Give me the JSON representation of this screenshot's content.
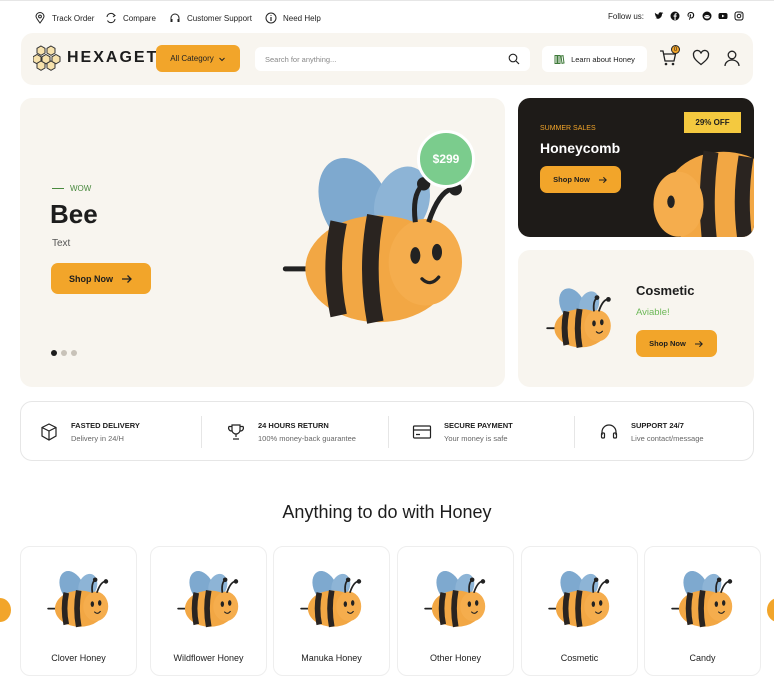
{
  "topbar": {
    "links": [
      {
        "label": "Track Order",
        "icon": "location-pin-icon"
      },
      {
        "label": "Compare",
        "icon": "compare-arrows-icon"
      },
      {
        "label": "Customer Support",
        "icon": "headphones-icon"
      },
      {
        "label": "Need Help",
        "icon": "info-icon"
      }
    ],
    "follow_label": "Follow us:",
    "socials": [
      "twitter-icon",
      "facebook-icon",
      "pinterest-icon",
      "reddit-icon",
      "youtube-icon",
      "instagram-icon"
    ]
  },
  "header": {
    "logo_text": "HEXAGET",
    "category_label": "All Category",
    "search_placeholder": "Search for anything...",
    "learn_label": "Learn about Honey",
    "cart_count": "0"
  },
  "hero": {
    "eyebrow": "WOW",
    "title": "Bee",
    "subtitle": "Text",
    "button": "Shop Now",
    "price": "$299",
    "slides": 3,
    "active_slide": 0
  },
  "promo": {
    "eyebrow": "SUMMER SALES",
    "title": "Honeycomb",
    "button": "Shop Now",
    "badge": "29% OFF"
  },
  "cosmetic": {
    "title": "Cosmetic",
    "subtitle": "Aviable!",
    "button": "Shop Now"
  },
  "features": [
    {
      "title": "FASTED DELIVERY",
      "subtitle": "Delivery in 24/H",
      "icon": "box-icon"
    },
    {
      "title": "24 HOURS RETURN",
      "subtitle": "100% money-back guarantee",
      "icon": "trophy-icon"
    },
    {
      "title": "SECURE PAYMENT",
      "subtitle": "Your money is safe",
      "icon": "credit-card-icon"
    },
    {
      "title": "SUPPORT 24/7",
      "subtitle": "Live contact/message",
      "icon": "headphones-icon"
    }
  ],
  "section": {
    "title": "Anything to do with Honey",
    "cards": [
      "Clover Honey",
      "Wildflower Honey",
      "Manuka Honey",
      "Other Honey",
      "Cosmetic",
      "Candy"
    ]
  },
  "colors": {
    "accent": "#f2a52a",
    "panel": "#f8f5ef",
    "dark": "#1e1b18",
    "price_badge": "#7bcc8d",
    "green_text": "#6cb857"
  }
}
